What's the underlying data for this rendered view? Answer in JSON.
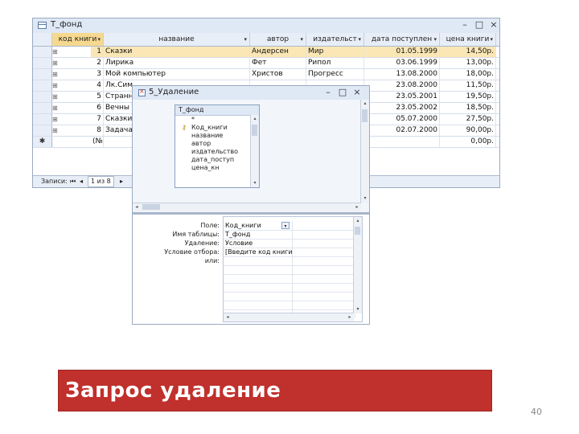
{
  "table_window": {
    "title": "Т_фонд",
    "controls": [
      "–",
      "□",
      "×"
    ],
    "columns": [
      {
        "label": "код книги",
        "arrow": "▾"
      },
      {
        "label": "название",
        "arrow": "▾"
      },
      {
        "label": "автор",
        "arrow": "▾"
      },
      {
        "label": "издательст",
        "arrow": "▾"
      },
      {
        "label": "дата поступлен",
        "arrow": "▾"
      },
      {
        "label": "цена книги",
        "arrow": "▾"
      }
    ],
    "rows": [
      {
        "sel": "",
        "exp": "⊞",
        "id": "1",
        "name": "Сказки",
        "author": "Андерсен",
        "publisher": "Мир",
        "date": "01.05.1999",
        "price": "14,50р."
      },
      {
        "sel": "",
        "exp": "⊞",
        "id": "2",
        "name": "Лирика",
        "author": "Фет",
        "publisher": "Рипол",
        "date": "03.06.1999",
        "price": "13,00р."
      },
      {
        "sel": "",
        "exp": "⊞",
        "id": "3",
        "name": "Мой компьютер",
        "author": "Христов",
        "publisher": "Прогресс",
        "date": "13.08.2000",
        "price": "18,00р."
      },
      {
        "sel": "",
        "exp": "⊞",
        "id": "4",
        "name": "Лк.Сим",
        "author": "",
        "publisher": "",
        "date": "23.08.2000",
        "price": "11,50р."
      },
      {
        "sel": "",
        "exp": "⊞",
        "id": "5",
        "name": "Странн",
        "author": "",
        "publisher": "",
        "date": "23.05.2001",
        "price": "19,50р."
      },
      {
        "sel": "",
        "exp": "⊞",
        "id": "6",
        "name": "Вечны",
        "author": "",
        "publisher": "",
        "date": "23.05.2002",
        "price": "18,50р."
      },
      {
        "sel": "",
        "exp": "⊞",
        "id": "7",
        "name": "Сказки",
        "author": "",
        "publisher": "",
        "date": "05.07.2000",
        "price": "27,50р."
      },
      {
        "sel": "",
        "exp": "⊞",
        "id": "8",
        "name": "Задача",
        "author": "",
        "publisher": "",
        "date": "02.07.2000",
        "price": "90,00р."
      },
      {
        "sel": "✱",
        "exp": "",
        "id": "(№)",
        "name": "",
        "author": "",
        "publisher": "",
        "date": "",
        "price": "0,00р."
      }
    ],
    "nav": {
      "label": "Записи:",
      "first": "⏮",
      "prev": "◂",
      "position": "1 из 8",
      "next": "▸"
    }
  },
  "query_window": {
    "title": "5_Удаление",
    "controls": [
      "–",
      "□",
      "×"
    ],
    "field_list": {
      "title": "Т_фонд",
      "items": [
        {
          "key": "",
          "label": "*"
        },
        {
          "key": "⚷",
          "label": "Код_книги"
        },
        {
          "key": "",
          "label": "название"
        },
        {
          "key": "",
          "label": "автор"
        },
        {
          "key": "",
          "label": "издательство"
        },
        {
          "key": "",
          "label": "дата_поступ"
        },
        {
          "key": "",
          "label": "цена_кн"
        }
      ]
    },
    "grid_labels": [
      "Поле:",
      "Имя таблицы:",
      "Удаление:",
      "Условие отбора:",
      "или:"
    ],
    "grid_values": [
      "Код_книги",
      "Т_фонд",
      "Условие",
      "[Введите код книги]",
      ""
    ],
    "dropdown_arrow": "▾"
  },
  "banner": {
    "text": "Запрос удаление"
  },
  "page_number": "40",
  "colors": {
    "banner": "#c0302c",
    "title_bar": "#dfe8f5",
    "selected_row": "#fbe7b5"
  }
}
